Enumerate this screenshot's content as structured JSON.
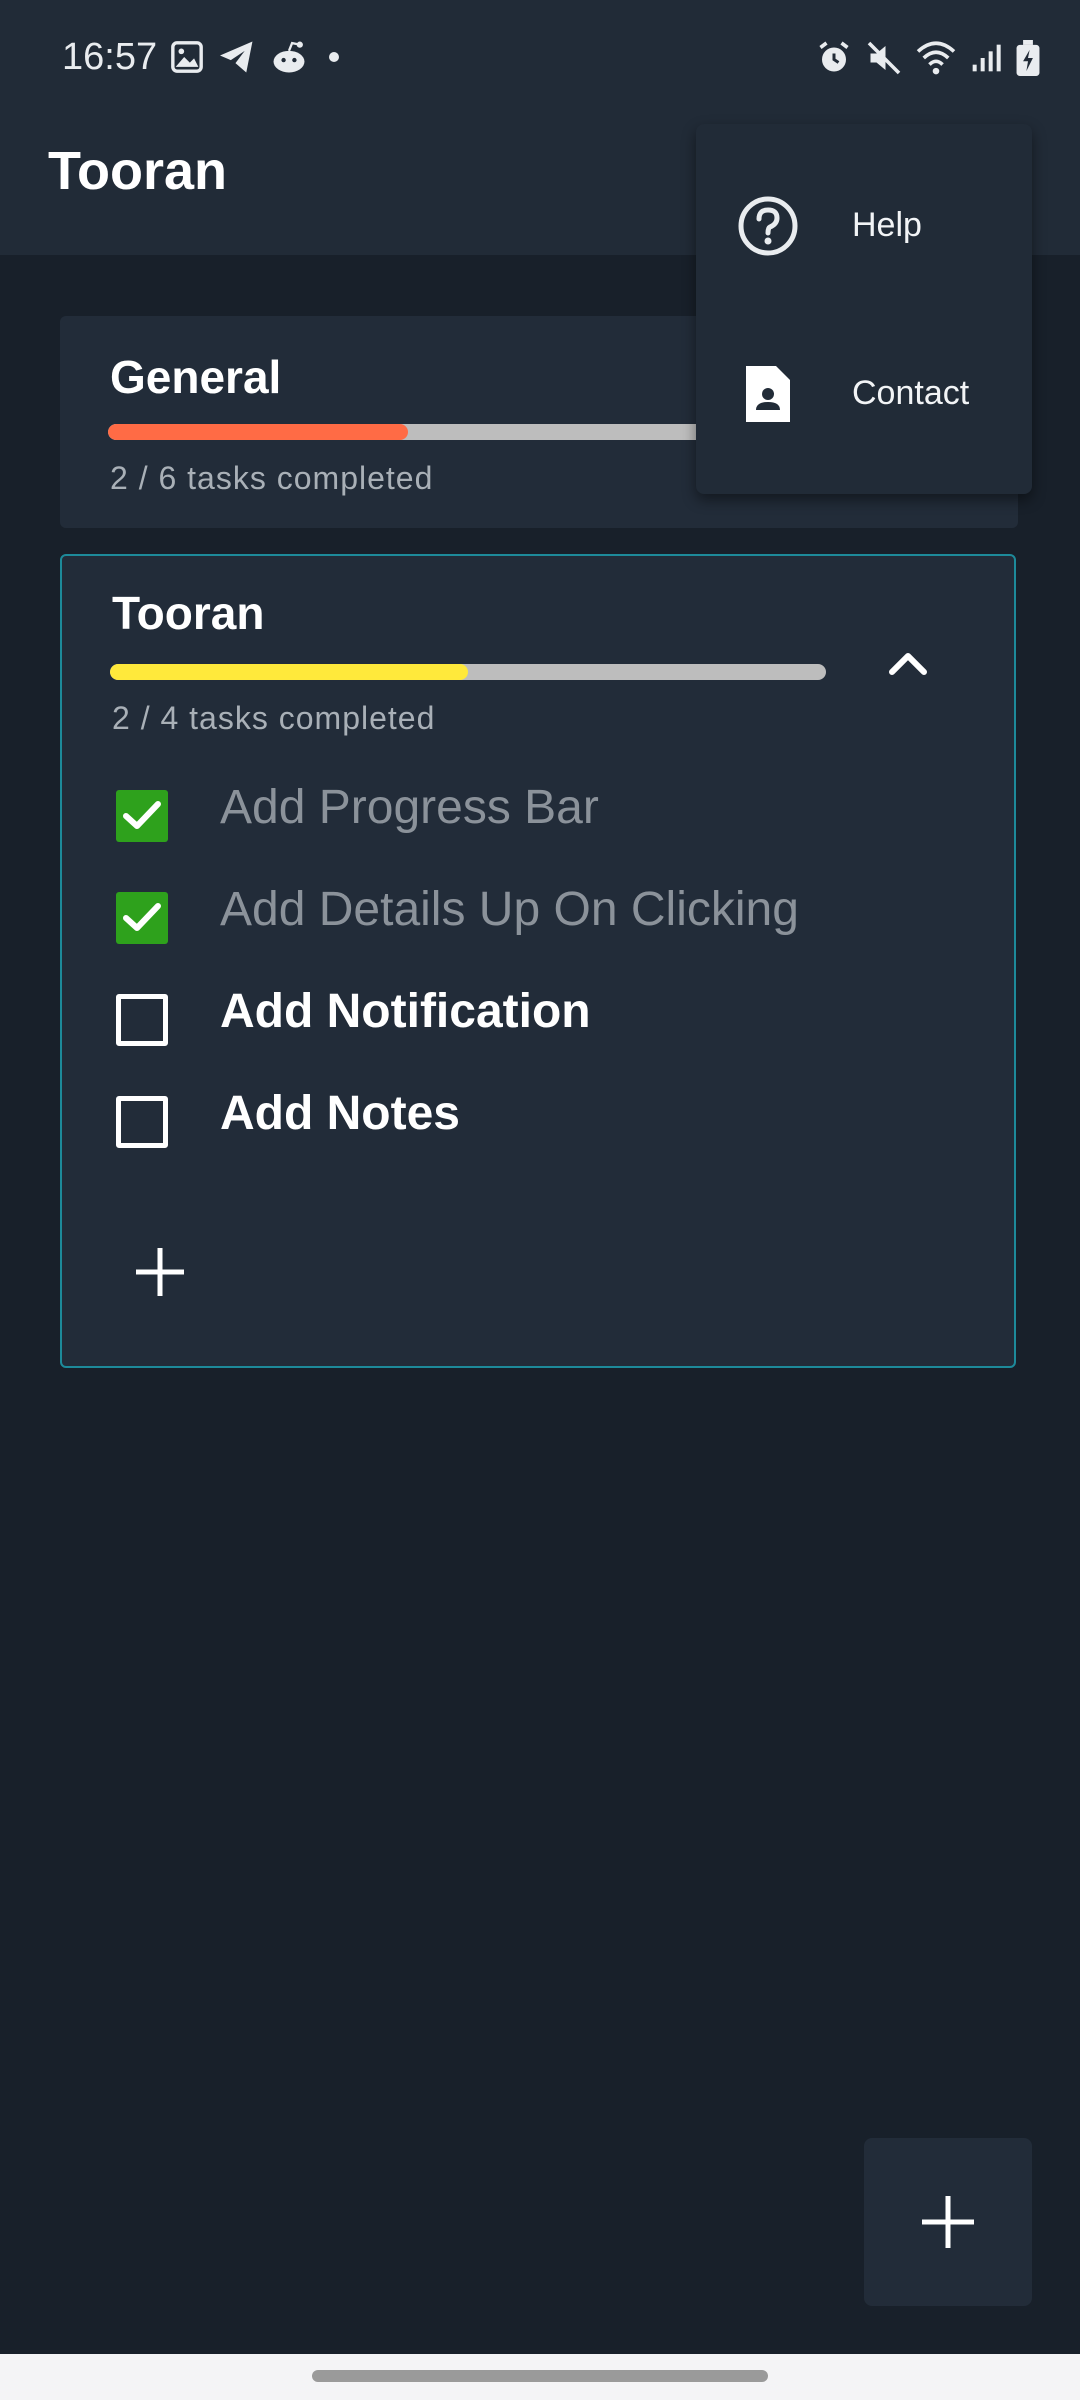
{
  "status_bar": {
    "time": "16:57",
    "left_icons": [
      "gallery-icon",
      "telegram-icon",
      "reddit-icon",
      "dot-icon"
    ],
    "right_icons": [
      "alarm-icon",
      "mute-icon",
      "wifi-icon",
      "signal-icon",
      "battery-icon"
    ]
  },
  "app_bar": {
    "title": "Tooran"
  },
  "lists": [
    {
      "name": "General",
      "progress_label": "2 / 6 tasks completed",
      "progress": 0.333,
      "progress_color": "#ff6b45"
    },
    {
      "name": "Tooran",
      "progress_label": "2 / 4 tasks completed",
      "progress": 0.5,
      "progress_color": "#ffe93b",
      "expanded": true,
      "tasks": [
        {
          "label": "Add Progress Bar",
          "done": true
        },
        {
          "label": "Add Details Up On Clicking",
          "done": true
        },
        {
          "label": "Add Notification",
          "done": false
        },
        {
          "label": "Add Notes",
          "done": false
        }
      ]
    }
  ],
  "menu": {
    "items": [
      {
        "label": "Help",
        "icon": "help-circle-icon"
      },
      {
        "label": "Contact",
        "icon": "contact-card-icon"
      }
    ]
  },
  "colors": {
    "background": "#18202a",
    "surface": "#222c39",
    "accent_border": "#1d8a9a",
    "checkbox_checked": "#2ea11c"
  }
}
